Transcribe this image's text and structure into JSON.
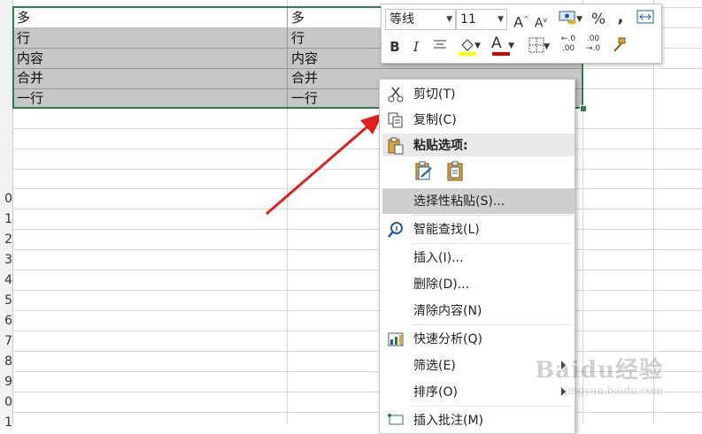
{
  "sheet": {
    "row_labels": [
      "",
      "",
      "",
      "",
      "",
      "",
      "",
      "",
      "",
      "0",
      "1",
      "2",
      "3",
      "4",
      "5",
      "6",
      "7",
      "8",
      "9",
      "0",
      "1"
    ],
    "selected_cells": [
      {
        "col_a": "多",
        "col_b": "多"
      },
      {
        "col_a": "行",
        "col_b": "行"
      },
      {
        "col_a": "内容",
        "col_b": "内容"
      },
      {
        "col_a": "合并",
        "col_b": "合并"
      },
      {
        "col_a": "一行",
        "col_b": "一行"
      }
    ]
  },
  "mini_toolbar": {
    "font_name": "等线",
    "font_size": "11",
    "increase_font": "A",
    "decrease_font": "A",
    "percent": "%",
    "comma": ",",
    "bold": "B",
    "italic": "I",
    "font_color_letter": "A",
    "decimal_up": "←.0 .00",
    "decimal_down": ".00 →.0",
    "font_color": "#e00000",
    "fill_color": "#ffff00"
  },
  "context_menu": {
    "items": [
      {
        "label": "剪切(T)",
        "icon": "scissors-icon"
      },
      {
        "label": "复制(C)",
        "icon": "copy-icon"
      },
      {
        "label": "粘贴选项:",
        "icon": "paste-icon"
      },
      {
        "label": "选择性粘贴(S)...",
        "icon": ""
      },
      {
        "label": "智能查找(L)",
        "icon": "smart-lookup-icon"
      },
      {
        "label": "插入(I)...",
        "icon": ""
      },
      {
        "label": "删除(D)...",
        "icon": ""
      },
      {
        "label": "清除内容(N)",
        "icon": ""
      },
      {
        "label": "快速分析(Q)",
        "icon": "quick-analysis-icon"
      },
      {
        "label": "筛选(E)",
        "icon": ""
      },
      {
        "label": "排序(O)",
        "icon": ""
      },
      {
        "label": "插入批注(M)",
        "icon": "comment-icon"
      }
    ]
  },
  "watermark": {
    "brand": "Baidu经验",
    "url": "jingyan.baidu.com"
  },
  "colors": {
    "selection_border": "#2e7d4f",
    "selection_fill": "#c6c6c6",
    "highlight": "#cfcfcf",
    "arrow": "#e02020"
  }
}
